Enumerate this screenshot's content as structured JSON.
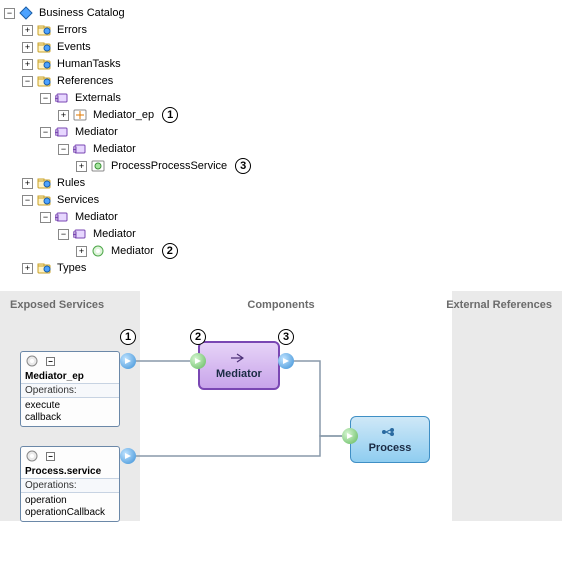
{
  "tree": {
    "root": "Business Catalog",
    "errors": "Errors",
    "events": "Events",
    "humantasks": "HumanTasks",
    "references": "References",
    "externals": "Externals",
    "mediator_ep": "Mediator_ep",
    "mediator": "Mediator",
    "processprocessservice": "ProcessProcessService",
    "rules": "Rules",
    "services": "Services",
    "types": "Types"
  },
  "callouts": {
    "one": "1",
    "two": "2",
    "three": "3"
  },
  "expander": {
    "plus": "+",
    "minus": "−"
  },
  "canvas": {
    "lane_exposed": "Exposed Services",
    "lane_components": "Components",
    "lane_external": "External References",
    "svc1": {
      "title": "Mediator_ep",
      "ops_label": "Operations:",
      "op1": "execute",
      "op2": "callback"
    },
    "svc2": {
      "title": "Process.service",
      "ops_label": "Operations:",
      "op1": "operation",
      "op2": "operationCallback"
    },
    "comp_mediator": "Mediator",
    "comp_process": "Process",
    "collapse": "−"
  }
}
